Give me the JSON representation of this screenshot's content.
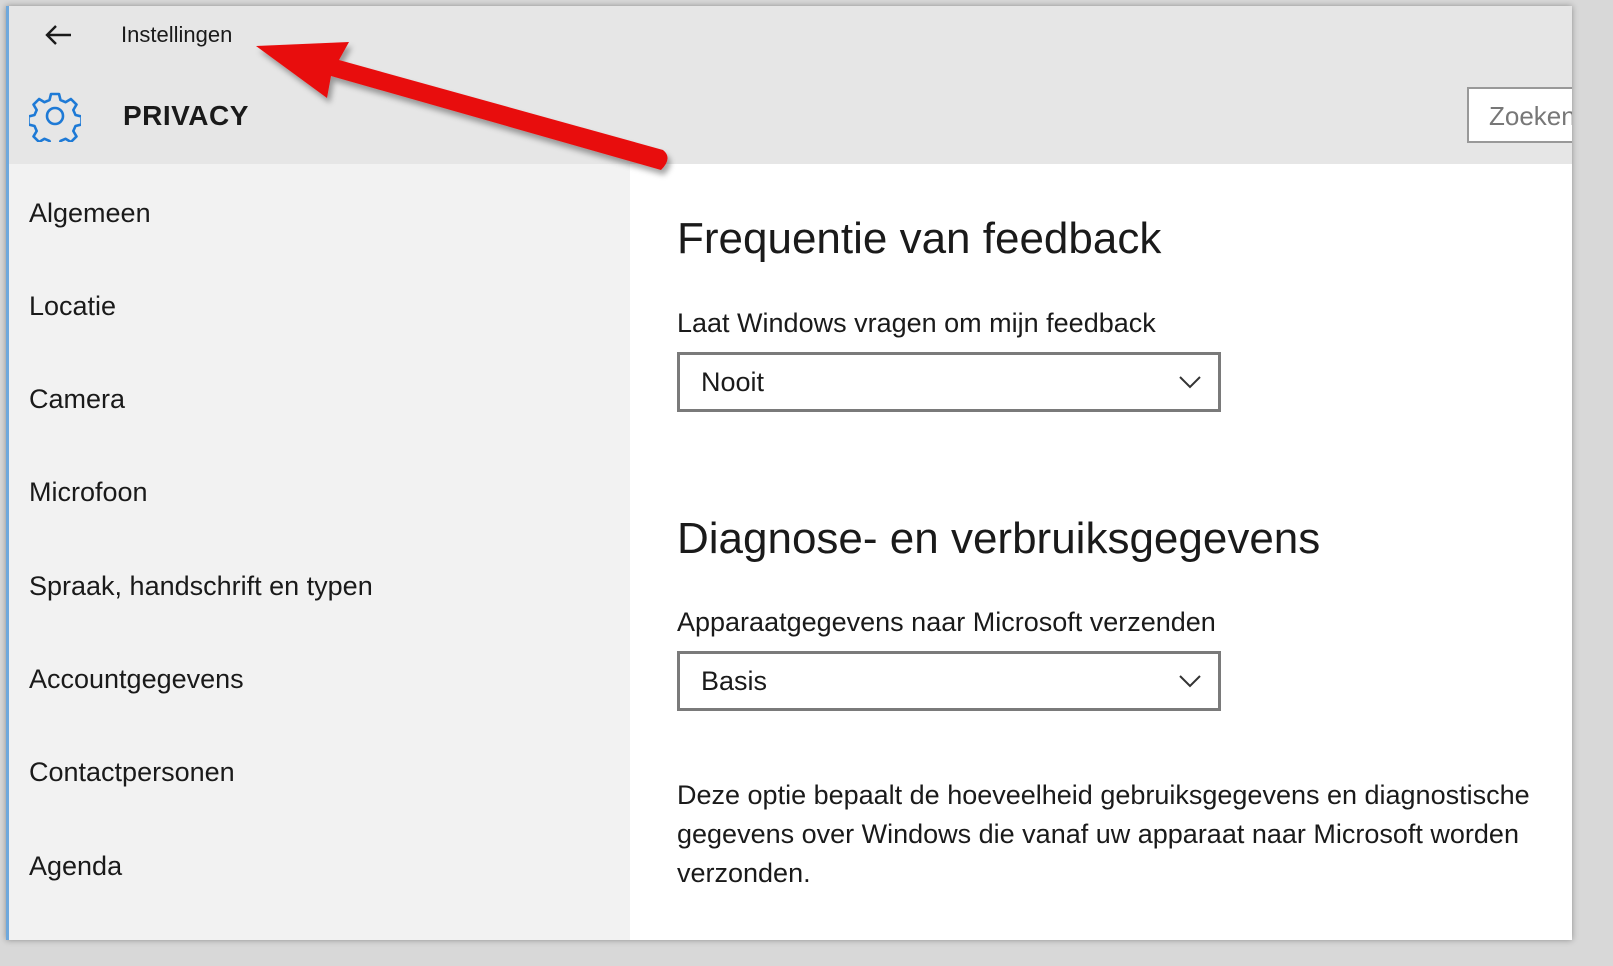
{
  "window": {
    "title": "Instellingen",
    "back_icon": "back-arrow-icon"
  },
  "header": {
    "icon": "gear-icon",
    "title": "PRIVACY",
    "search_placeholder": "Zoeken"
  },
  "sidebar": {
    "items": [
      {
        "label": "Algemeen"
      },
      {
        "label": "Locatie"
      },
      {
        "label": "Camera"
      },
      {
        "label": "Microfoon"
      },
      {
        "label": "Spraak, handschrift en typen"
      },
      {
        "label": "Accountgegevens"
      },
      {
        "label": "Contactpersonen"
      },
      {
        "label": "Agenda"
      }
    ]
  },
  "main": {
    "feedback": {
      "heading": "Frequentie van feedback",
      "label": "Laat Windows vragen om mijn feedback",
      "value": "Nooit"
    },
    "diagnostics": {
      "heading": "Diagnose- en verbruiksgegevens",
      "label": "Apparaatgegevens naar Microsoft verzenden",
      "value": "Basis",
      "description": "Deze optie bepaalt de hoeveelheid gebruiksgegevens en diagnostische gegevens over Windows die vanaf uw apparaat naar Microsoft worden verzonden."
    }
  },
  "annotation": {
    "arrow_color": "#e81010"
  },
  "colors": {
    "accent": "#1e7ad6",
    "header_bg": "#e6e6e6",
    "sidebar_bg": "#f2f2f2",
    "content_bg": "#ffffff"
  }
}
